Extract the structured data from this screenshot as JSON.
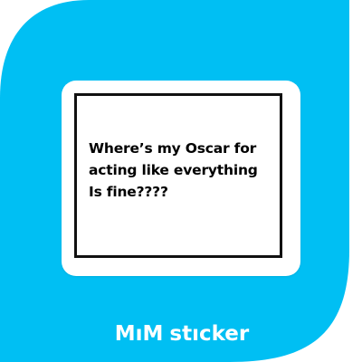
{
  "colors": {
    "background": "#ffffff",
    "accent": "#00bff3",
    "sticker_background": "#ffffff",
    "text": "#000000"
  },
  "sticker": {
    "lines": [
      "Where’s my Oscar for",
      "acting like everything",
      "Is fine????"
    ]
  },
  "brand": {
    "mark": "MıM",
    "word": "stıcker"
  }
}
